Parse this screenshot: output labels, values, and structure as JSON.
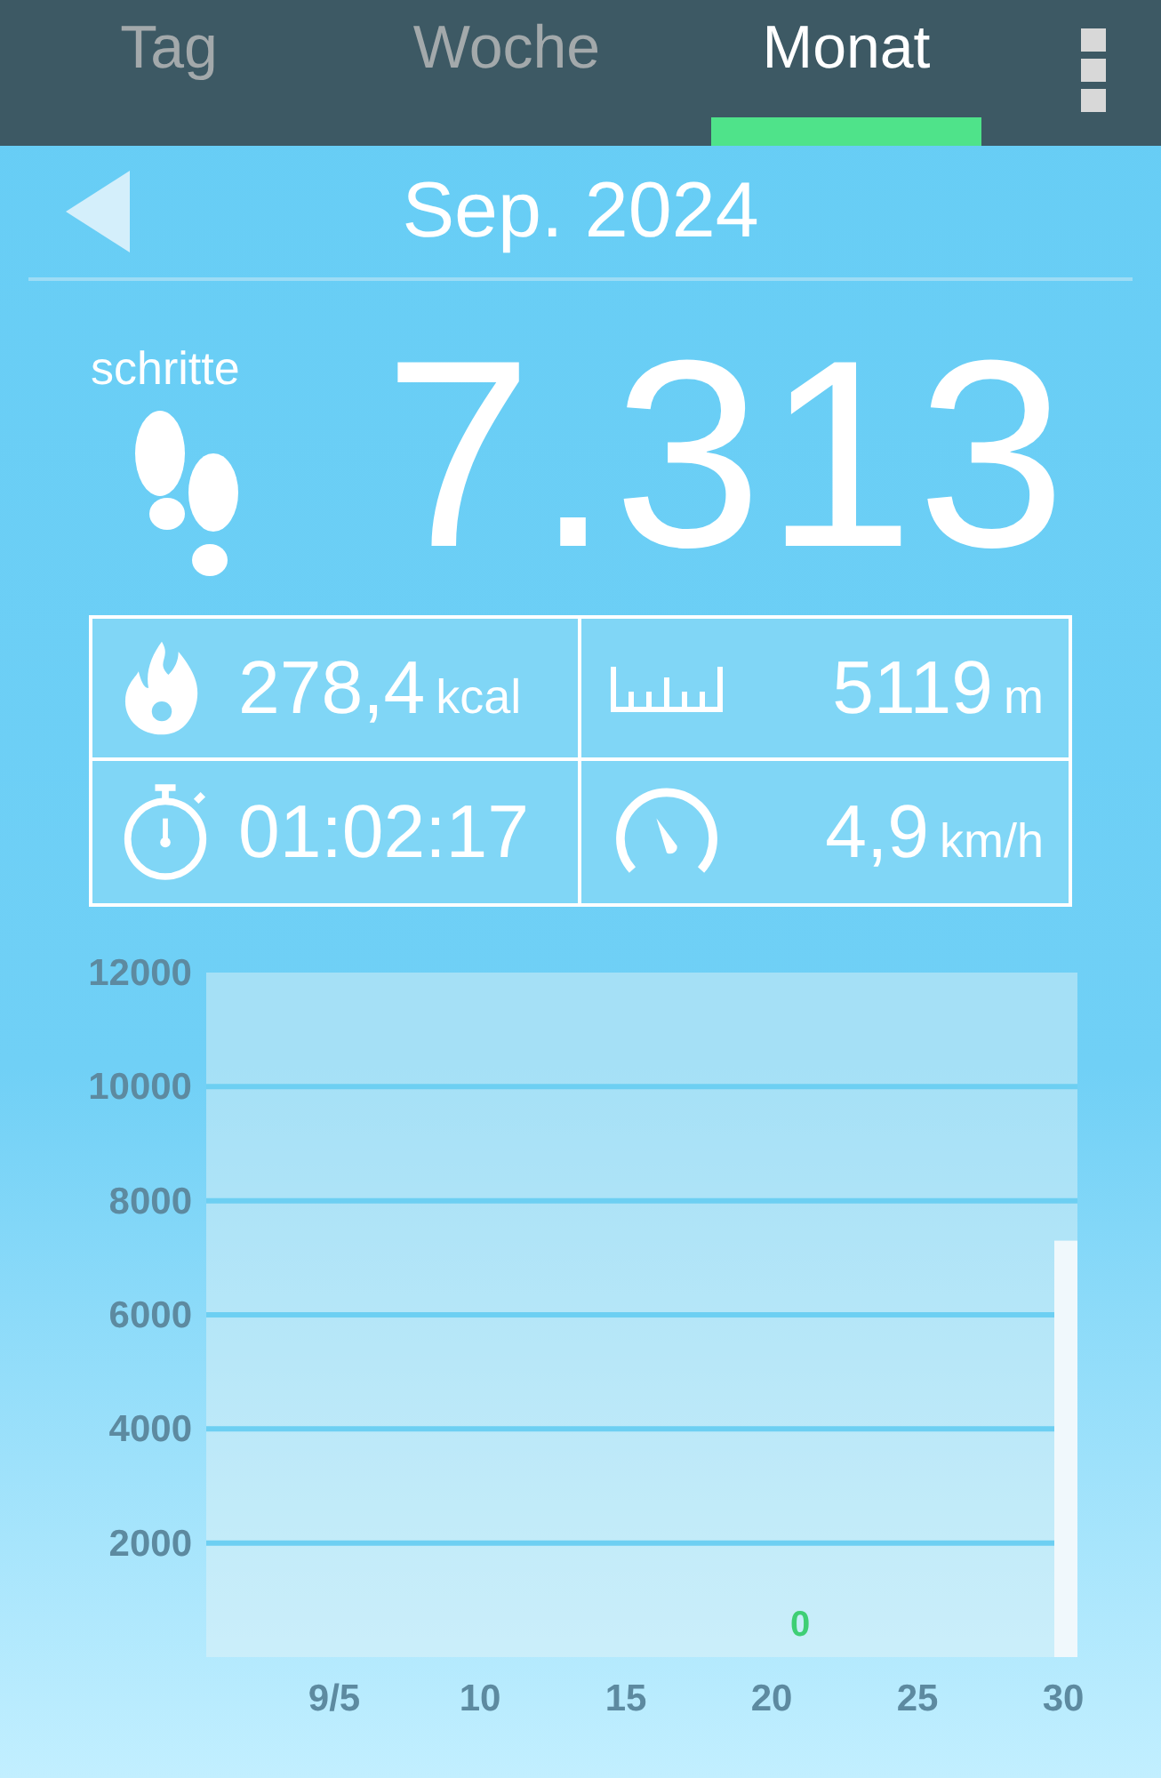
{
  "tabs": [
    {
      "label": "Tag",
      "selected": false
    },
    {
      "label": "Woche",
      "selected": false
    },
    {
      "label": "Monat",
      "selected": true
    }
  ],
  "period": {
    "label": "Sep. 2024"
  },
  "steps": {
    "label": "schritte",
    "value": "7.313"
  },
  "stats": [
    {
      "kind": "calories",
      "value": "278,4",
      "unit": "kcal"
    },
    {
      "kind": "distance",
      "value": "5119",
      "unit": "m"
    },
    {
      "kind": "duration",
      "value": "01:02:17"
    },
    {
      "kind": "speed",
      "value": "4,9",
      "unit": "km/h"
    }
  ],
  "chart_data": {
    "type": "bar",
    "categories": [
      "9/5",
      "10",
      "15",
      "20",
      "25",
      "30"
    ],
    "series": [
      {
        "color": "#f0f8fc",
        "values": [
          null,
          null,
          null,
          null,
          null,
          7300
        ]
      }
    ],
    "grid": true,
    "ylim": [
      0,
      12000
    ],
    "yticks": [
      2000,
      4000,
      6000,
      8000,
      10000,
      12000
    ],
    "annotations": [
      "0"
    ]
  }
}
